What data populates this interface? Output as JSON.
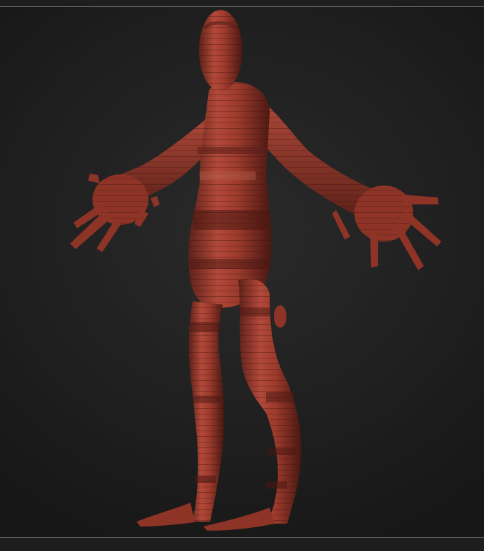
{
  "viewport": {
    "background_color": "#202020",
    "frame_line_color": "#6a6a6a"
  },
  "model": {
    "material_color": "#9b3a2c",
    "band_dark_color": "#5a1f17",
    "band_light_color": "#c76a55"
  }
}
